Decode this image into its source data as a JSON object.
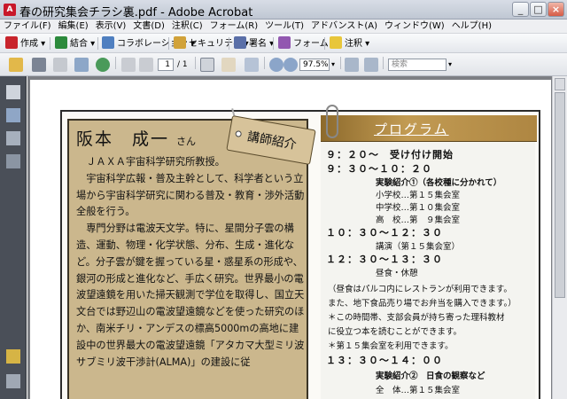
{
  "window": {
    "title": "春の研究集会チラシ裏.pdf - Adobe Acrobat",
    "app_icon_label": "A"
  },
  "menu": [
    "ファイル(F)",
    "編集(E)",
    "表示(V)",
    "文書(D)",
    "注釈(C)",
    "フォーム(R)",
    "ツール(T)",
    "アドバンスト(A)",
    "ウィンドウ(W)",
    "ヘルプ(H)"
  ],
  "toolbar": {
    "create": "作成",
    "combine": "結合",
    "collaborate": "コラボレーション",
    "security": "セキュリティ",
    "sign": "署名",
    "forms": "フォーム",
    "comment": "注釈"
  },
  "nav": {
    "page_current": "1",
    "page_total": "/ 1",
    "zoom": "97.5%",
    "search_placeholder": "検索"
  },
  "colors": {
    "accent": "#1f5fa8",
    "card": "#cbb78d",
    "header": "#a57c38"
  },
  "flyer": {
    "speaker_name": "阪本　成一",
    "honorific": "さん",
    "tag_label": "講師紹介",
    "bio": [
      "ＪＡＸＡ宇宙科学研究所教授。",
      "宇宙科学広報・普及主幹として、科学者という立場から宇宙科学研究に関わる普及・教育・渉外活動全般を行う。",
      "専門分野は電波天文学。特に、星間分子雲の構造、運動、物理・化学状態、分布、生成・進化など。分子雲が鍵を握っている星・惑星系の形成や、銀河の形成と進化など、手広く研究。世界最小の電波望遠鏡を用いた掃天観測で学位を取得し、国立天文台では野辺山の電波望遠鏡などを使った研究のほか、南米チリ・アンデスの標高5000mの高地に建設中の世界最大の電波望遠鏡「アタカマ大型ミリ波サブミリ波干渉計(ALMA)」の建設に従"
    ],
    "program_title": "プログラム",
    "program": [
      {
        "kind": "time",
        "text": "９：２０〜　受け付け開始"
      },
      {
        "kind": "time",
        "text": "９：３０〜１０：２０"
      },
      {
        "kind": "sub",
        "text": "実験紹介①（各校種に分かれて）"
      },
      {
        "kind": "item",
        "text": "小学校…第１５集会室"
      },
      {
        "kind": "item",
        "text": "中学校…第１０集会室"
      },
      {
        "kind": "item",
        "text": "高　校…第　９集会室"
      },
      {
        "kind": "time",
        "text": "１０：３０〜１２：３０"
      },
      {
        "kind": "item",
        "text": "講演（第１５集会室）"
      },
      {
        "kind": "time",
        "text": "１２：３０〜１３：３０"
      },
      {
        "kind": "item",
        "text": "昼食・休憩"
      },
      {
        "kind": "note",
        "text": "（昼食はパルコ内にレストランが利用できます。"
      },
      {
        "kind": "note",
        "text": "また、地下食品売り場でお弁当を購入できます。）"
      },
      {
        "kind": "note",
        "text": "＊この時間帯、支部会員が持ち寄った理科教材"
      },
      {
        "kind": "note",
        "text": "に役立つ本を読むことができます。"
      },
      {
        "kind": "note",
        "text": "＊第１５集会室を利用できます。"
      },
      {
        "kind": "time",
        "text": "１３：３０〜１４：００"
      },
      {
        "kind": "sub",
        "text": "実験紹介②　日食の観察など"
      },
      {
        "kind": "item",
        "text": "全　体…第１５集会室"
      }
    ]
  }
}
